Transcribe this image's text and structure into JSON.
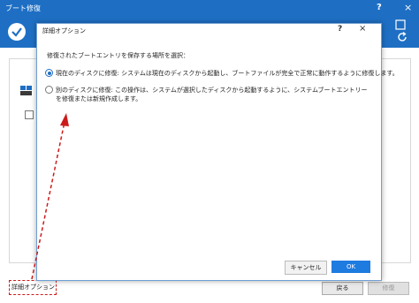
{
  "app": {
    "title": "ブート修復",
    "help": "?",
    "close": "×",
    "footer_link": "詳細オプション",
    "back_button": "戻る",
    "repair_button": "修復"
  },
  "dialog": {
    "title": "詳細オプション",
    "help": "?",
    "close": "×",
    "prompt": "修復されたブートエントリを保存する場所を選択：",
    "options": [
      {
        "label": "現在のディスクに修復: システムは現在のディスクから起動し、ブートファイルが完全で正常に動作するように修復します。",
        "selected": true
      },
      {
        "label": "別のディスクに修復: この操作は、システムが選択したディスクから起動するように、システムブートエントリーを修復または新規作成します。",
        "selected": false
      }
    ],
    "cancel_button": "キャンセル",
    "ok_button": "OK"
  },
  "colors": {
    "brand": "#1e6fc4",
    "ok": "#1e7be0",
    "highlight": "#cc1b1b"
  },
  "icons": [
    "check-icon",
    "refresh-icon",
    "disk-icon",
    "arrow-annotation"
  ]
}
